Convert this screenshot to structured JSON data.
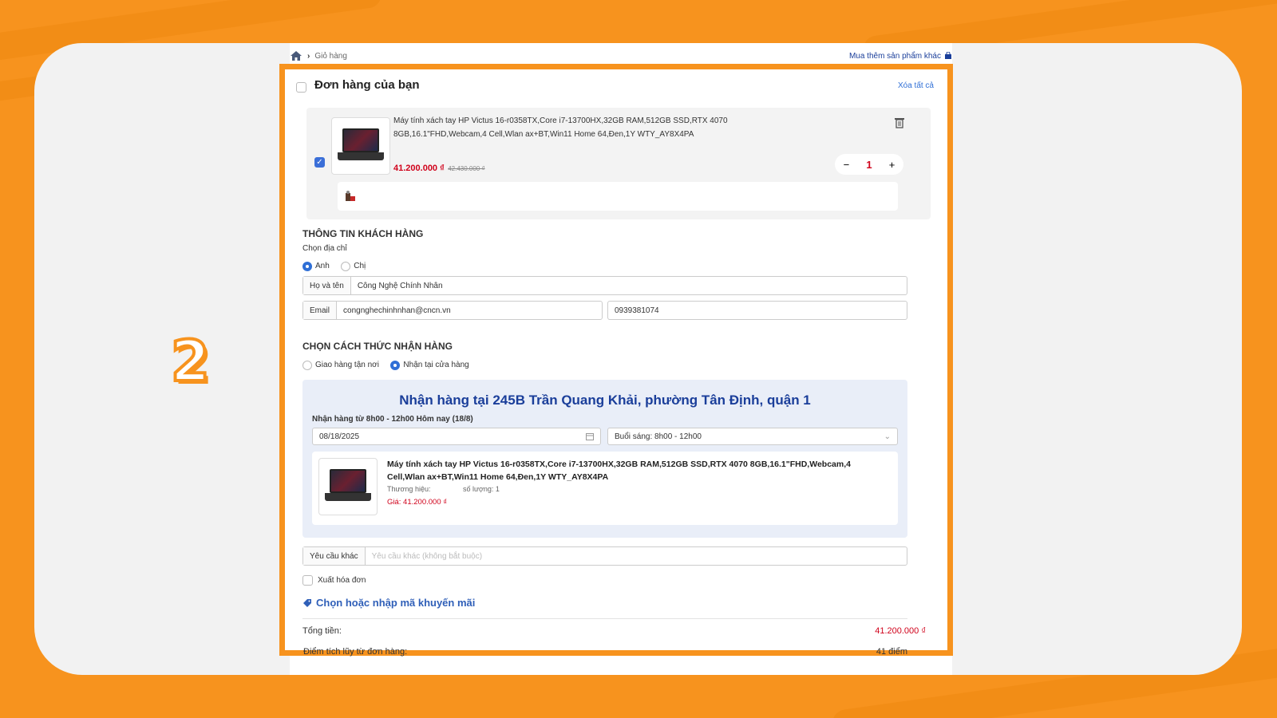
{
  "step_number": "2",
  "breadcrumb": {
    "current": "Giỏ hàng",
    "more_link": "Mua thêm sản phẩm khác"
  },
  "cart": {
    "title": "Đơn hàng của bạn",
    "clear_all": "Xóa tất cả",
    "item": {
      "name_line1": "Máy tính xách tay HP Victus 16-r0358TX,Core i7-13700HX,32GB RAM,512GB SSD,RTX 4070",
      "name_line2": "8GB,16.1\"FHD,Webcam,4 Cell,Wlan ax+BT,Win11 Home 64,Đen,1Y WTY_AY8X4PA",
      "price": "41.200.000 ₫",
      "old_price": "42.430.000 ₫",
      "quantity": "1",
      "minus": "−",
      "plus": "+"
    }
  },
  "customer": {
    "heading": "THÔNG TIN KHÁCH HÀNG",
    "choose_address": "Chọn địa chỉ",
    "salutation_options": [
      "Anh",
      "Chị"
    ],
    "salutation_selected": "Anh",
    "name_label": "Họ và tên",
    "name_value": "Công Nghệ Chính Nhân",
    "email_label": "Email",
    "email_value": "congnghechinhnhan@cncn.vn",
    "phone_value": "0939381074"
  },
  "delivery": {
    "heading": "CHỌN CÁCH THỨC NHẬN HÀNG",
    "options": [
      "Giao hàng tận nơi",
      "Nhận tại cửa hàng"
    ],
    "selected": "Nhận tại cửa hàng",
    "store_title": "Nhận hàng tại 245B Trần Quang Khải, phường Tân Định, quận 1",
    "pickup_note": "Nhận hàng từ 8h00 - 12h00 Hôm nay (18/8)",
    "date_value": "08/18/2025",
    "time_value": "Buổi sáng: 8h00 - 12h00",
    "product": {
      "name_line1": "Máy tính xách tay HP Victus 16-r0358TX,Core i7-13700HX,32GB RAM,512GB SSD,RTX 4070 8GB,16.1\"FHD,Webcam,4",
      "name_line2": "Cell,Wlan ax+BT,Win11 Home 64,Đen,1Y WTY_AY8X4PA",
      "brand_label": "Thương hiệu:",
      "qty_label": "số lượng: 1",
      "price_label": "Giá: 41.200.000 ₫"
    }
  },
  "extra": {
    "request_label": "Yêu cầu khác",
    "request_placeholder": "Yêu cầu khác (không bắt buộc)",
    "invoice_label": "Xuất hóa đơn",
    "promo_label": "Chọn hoặc nhập mã khuyến mãi"
  },
  "summary": {
    "total_label": "Tổng tiền:",
    "total_value": "41.200.000 ₫",
    "points_label": "Điểm tích lũy từ đơn hàng:",
    "points_value": "41 điểm"
  },
  "colors": {
    "accent": "#f7931e",
    "link": "#2f6fd6",
    "price": "#d0021b",
    "store_bg": "#e9eef8"
  }
}
